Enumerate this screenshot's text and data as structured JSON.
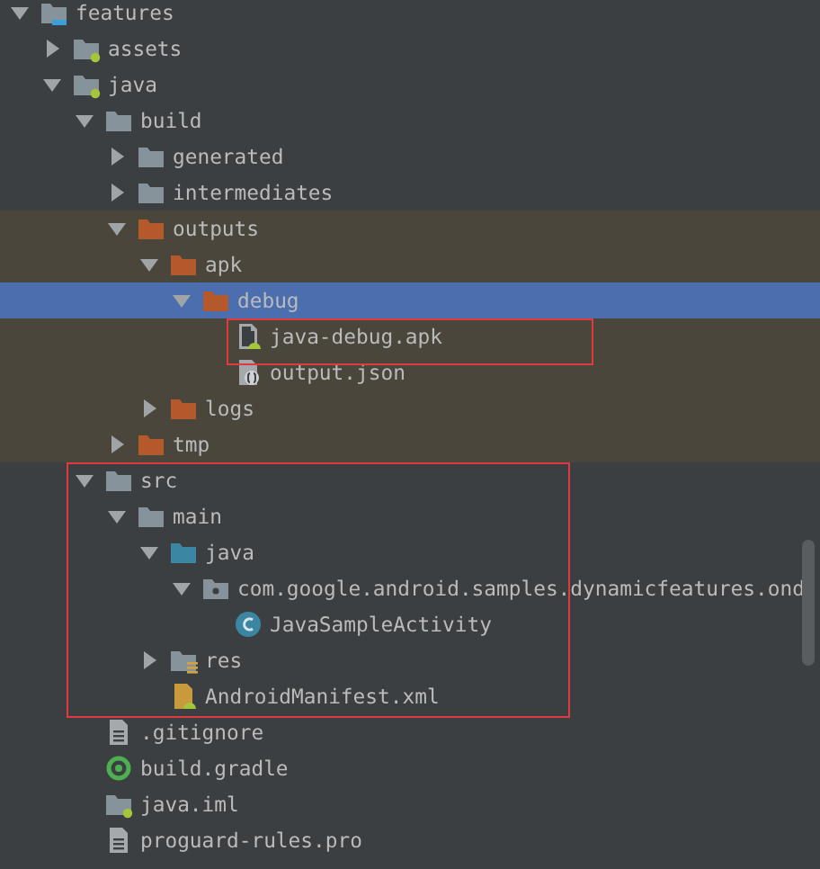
{
  "tree": {
    "name": "features",
    "kind": "module",
    "expanded": true,
    "selected": false,
    "tinted": false,
    "framed": false,
    "children": [
      {
        "name": "assets",
        "kind": "source-folder",
        "expanded": false,
        "selected": false,
        "tinted": false,
        "framed": false
      },
      {
        "name": "java",
        "kind": "source-folder",
        "expanded": true,
        "selected": false,
        "tinted": false,
        "framed": false,
        "children": [
          {
            "name": "build",
            "kind": "folder",
            "expanded": true,
            "selected": false,
            "tinted": false,
            "framed": false,
            "children": [
              {
                "name": "generated",
                "kind": "folder",
                "expanded": false,
                "selected": false,
                "tinted": false,
                "framed": false
              },
              {
                "name": "intermediates",
                "kind": "folder",
                "expanded": false,
                "selected": false,
                "tinted": false,
                "framed": false
              },
              {
                "name": "outputs",
                "kind": "excluded-folder",
                "expanded": true,
                "selected": false,
                "tinted": true,
                "framed": false,
                "children": [
                  {
                    "name": "apk",
                    "kind": "excluded-folder",
                    "expanded": true,
                    "selected": false,
                    "tinted": true,
                    "framed": false,
                    "children": [
                      {
                        "name": "debug",
                        "kind": "excluded-folder",
                        "expanded": true,
                        "selected": true,
                        "framed": false,
                        "children": [
                          {
                            "name": "java-debug.apk",
                            "kind": "apk",
                            "selected": false,
                            "tinted": true,
                            "framed": true
                          },
                          {
                            "name": "output.json",
                            "kind": "json",
                            "selected": false,
                            "tinted": true,
                            "framed": false
                          }
                        ]
                      }
                    ]
                  },
                  {
                    "name": "logs",
                    "kind": "excluded-folder",
                    "expanded": false,
                    "selected": false,
                    "tinted": true,
                    "framed": false
                  }
                ]
              },
              {
                "name": "tmp",
                "kind": "excluded-folder",
                "expanded": false,
                "selected": false,
                "tinted": true,
                "framed": false
              }
            ]
          },
          {
            "name": "src",
            "kind": "folder",
            "expanded": true,
            "selected": false,
            "tinted": false,
            "framed": true,
            "children": [
              {
                "name": "main",
                "kind": "folder",
                "expanded": true,
                "selected": false,
                "tinted": false,
                "framed": false,
                "children": [
                  {
                    "name": "java",
                    "kind": "java-folder",
                    "expanded": true,
                    "selected": false,
                    "tinted": false,
                    "framed": false,
                    "children": [
                      {
                        "name": "com.google.android.samples.dynamicfeatures.ond",
                        "kind": "package",
                        "expanded": true,
                        "selected": false,
                        "tinted": false,
                        "framed": false,
                        "children": [
                          {
                            "name": "JavaSampleActivity",
                            "kind": "class",
                            "selected": false,
                            "tinted": false,
                            "framed": false
                          }
                        ]
                      }
                    ]
                  },
                  {
                    "name": "res",
                    "kind": "res-folder",
                    "expanded": false,
                    "selected": false,
                    "tinted": false,
                    "framed": false
                  },
                  {
                    "name": "AndroidManifest.xml",
                    "kind": "manifest",
                    "selected": false,
                    "tinted": false,
                    "framed": false
                  }
                ]
              }
            ]
          },
          {
            "name": ".gitignore",
            "kind": "text-file",
            "selected": false,
            "tinted": false,
            "framed": false
          },
          {
            "name": "build.gradle",
            "kind": "gradle",
            "selected": false,
            "tinted": false,
            "framed": false
          },
          {
            "name": "java.iml",
            "kind": "iml",
            "selected": false,
            "tinted": false,
            "framed": false
          },
          {
            "name": "proguard-rules.pro",
            "kind": "text-file",
            "selected": false,
            "tinted": false,
            "framed": false
          }
        ]
      }
    ]
  }
}
